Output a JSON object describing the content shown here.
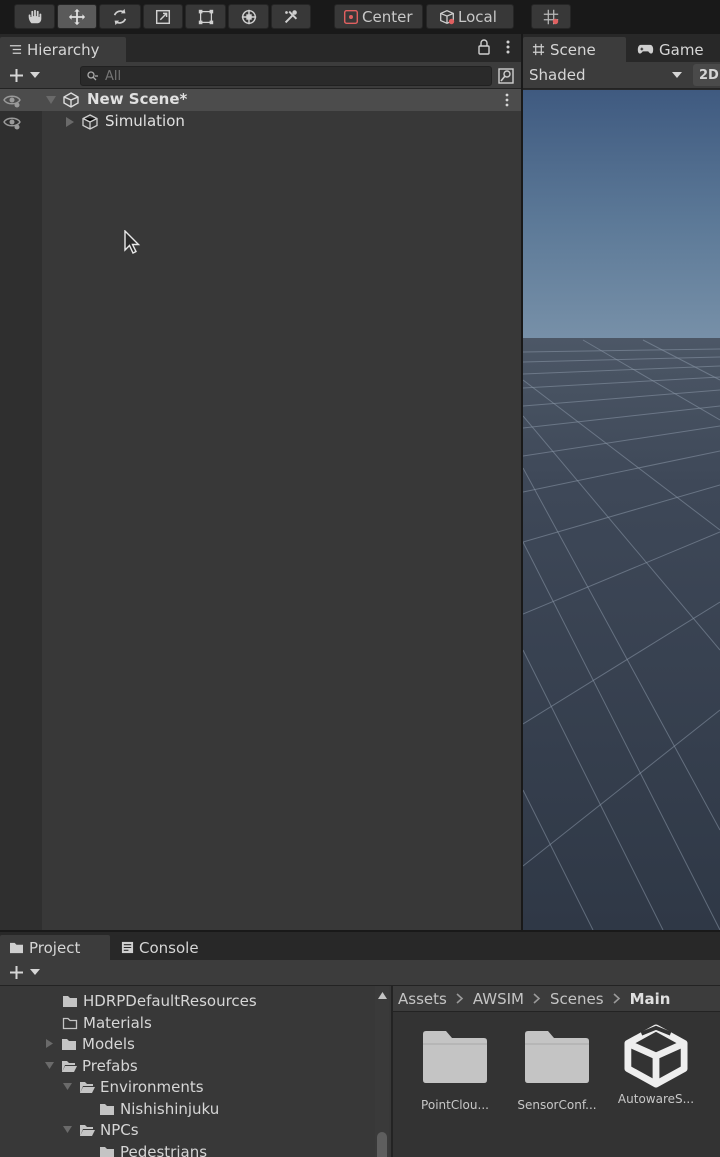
{
  "toolbar": {
    "tools": [
      "hand-tool",
      "move-tool",
      "rotate-tool",
      "scale-tool",
      "rect-tool",
      "transform-tool",
      "custom-tool"
    ],
    "active_tool": "move-tool",
    "pivot_label": "Center",
    "space_label": "Local"
  },
  "hierarchy": {
    "tab_label": "Hierarchy",
    "search_placeholder": "All",
    "scene_name": "New Scene*",
    "items": [
      {
        "label": "Simulation"
      }
    ]
  },
  "scene_view": {
    "tab_scene": "Scene",
    "tab_game": "Game",
    "draw_mode": "Shaded",
    "mode_2d": "2D"
  },
  "project": {
    "tab_project": "Project",
    "tab_console": "Console",
    "tree": [
      {
        "label": "HDRPDefaultResources"
      },
      {
        "label": "Materials"
      },
      {
        "label": "Models"
      },
      {
        "label": "Prefabs"
      },
      {
        "label": "Environments"
      },
      {
        "label": "Nishishinjuku"
      },
      {
        "label": "NPCs"
      },
      {
        "label": "Pedestrians"
      }
    ],
    "breadcrumb": [
      "Assets",
      "AWSIM",
      "Scenes",
      "Main"
    ],
    "assets": [
      {
        "name": "PointClou..."
      },
      {
        "name": "SensorConf..."
      },
      {
        "name": "AutowareS..."
      }
    ]
  },
  "colors": {
    "panel": "#383838",
    "toolbar": "#191919",
    "selected_row": "#4c4c4c",
    "folder": "#c4c4c4"
  }
}
